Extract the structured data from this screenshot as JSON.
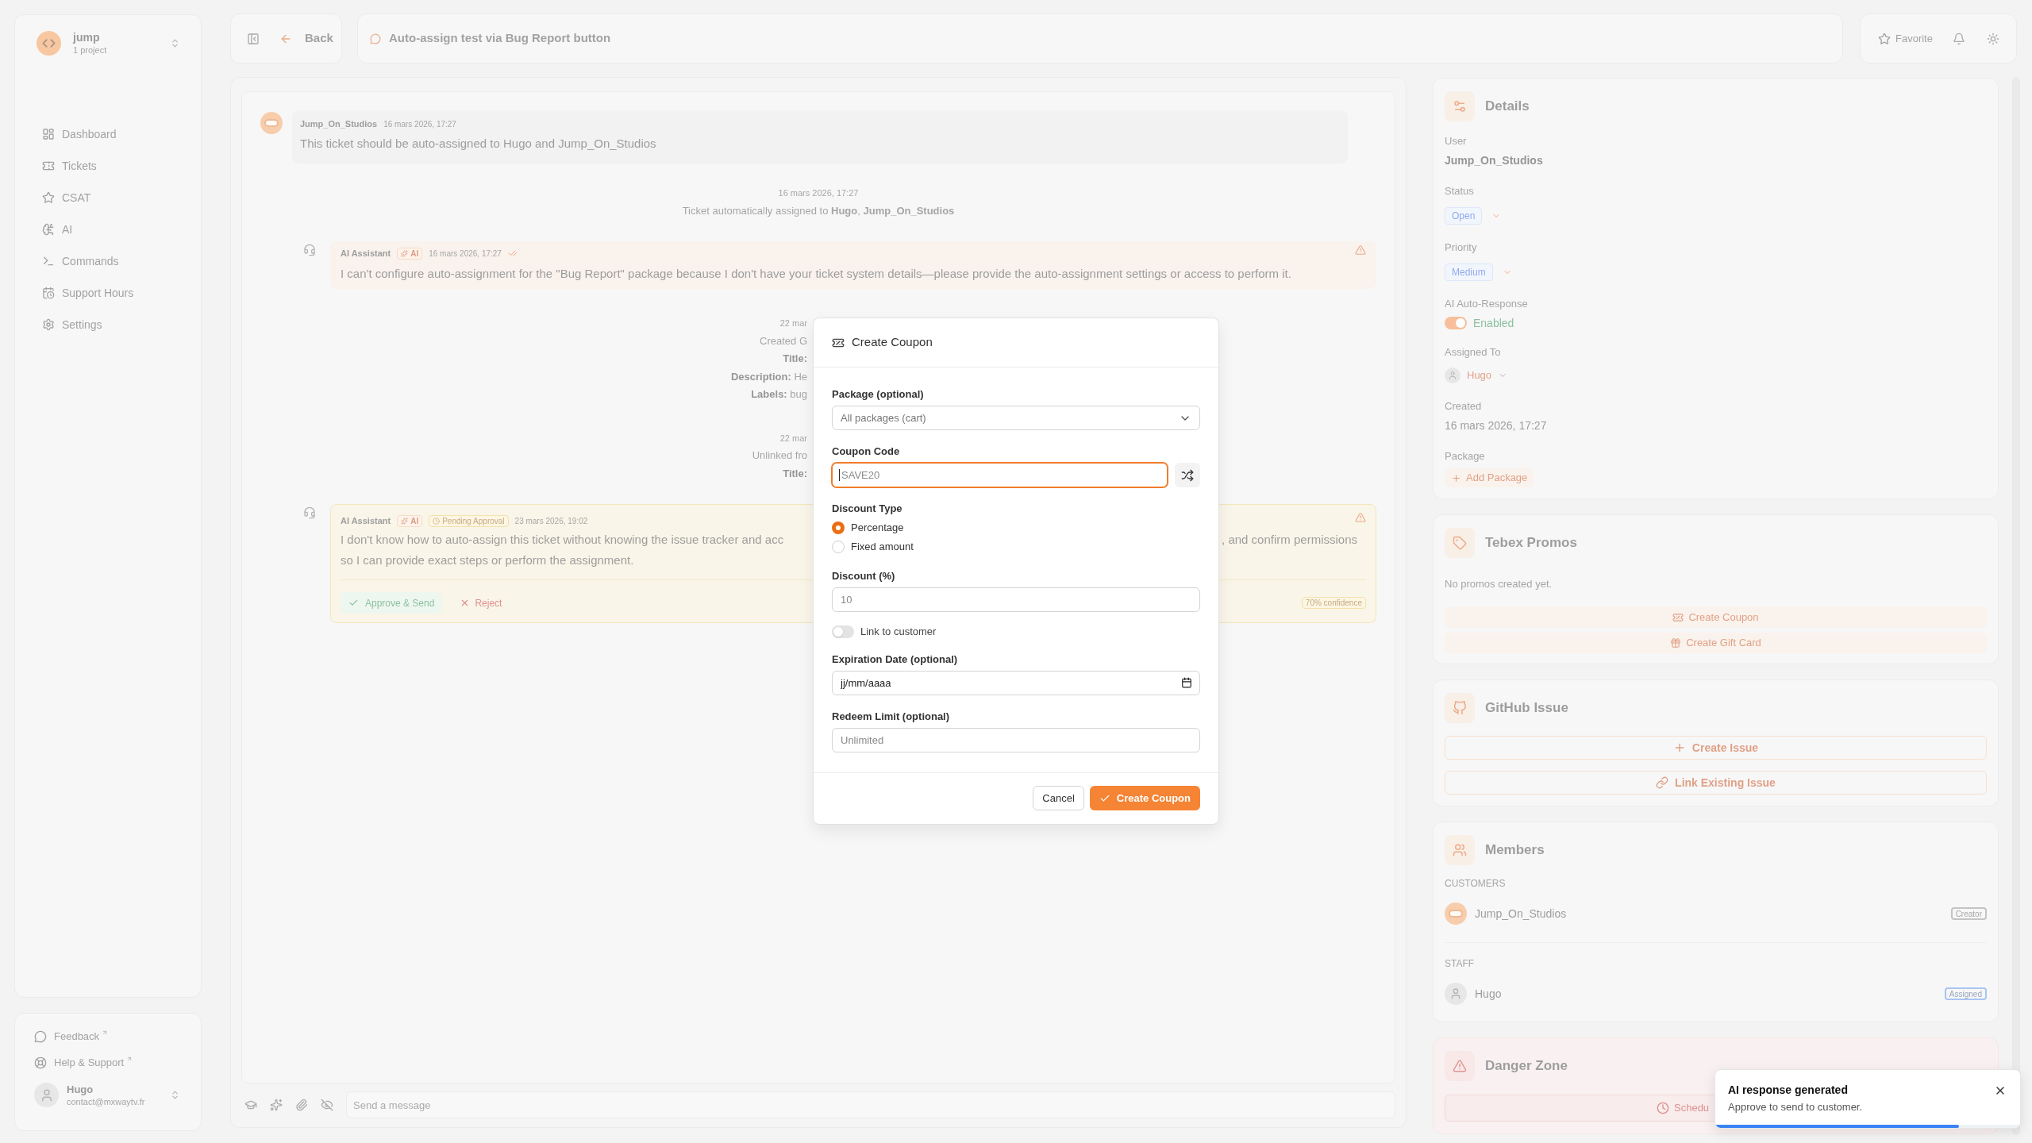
{
  "sidebar": {
    "workspace": {
      "name": "jump",
      "subtitle": "1 project"
    },
    "nav": [
      {
        "label": "Dashboard",
        "selected": false
      },
      {
        "label": "Tickets",
        "selected": false
      },
      {
        "label": "CSAT",
        "selected": false
      },
      {
        "label": "AI",
        "selected": false
      },
      {
        "label": "Commands",
        "selected": false
      },
      {
        "label": "Support Hours",
        "selected": false
      },
      {
        "label": "Settings",
        "selected": false
      }
    ],
    "links": [
      "Feedback",
      "Help & Support"
    ],
    "user": {
      "name": "Hugo",
      "email": "contact@mxwaytv.fr"
    }
  },
  "topbar": {
    "back": "Back",
    "title": "Auto-assign test via Bug Report button",
    "favorite": "Favorite"
  },
  "chat": {
    "messages": [
      {
        "kind": "customer",
        "author": "Jump_On_Studios",
        "time": "16 mars 2026, 17:27",
        "text": "This ticket should be auto-assigned to Hugo and Jump_On_Studios"
      },
      {
        "kind": "event",
        "date": "16 mars 2026, 17:27",
        "lines": [
          {
            "text": "Ticket automatically assigned to **Hugo**, **Jump_On_Studios**"
          }
        ]
      },
      {
        "kind": "assistant",
        "author": "AI Assistant",
        "badge": "AI",
        "time": "16 mars 2026, 17:27",
        "read": true,
        "pending": false,
        "text": "I can't configure auto-assignment for the \"Bug Report\" package because I don't have your ticket system details—please provide the auto-assignment settings or access to perform it."
      },
      {
        "kind": "clipped",
        "date": "22 mar",
        "lines": [
          {
            "text": "Created G"
          },
          {
            "label": "Title:"
          },
          {
            "label": "Description:",
            "value": "He"
          },
          {
            "label": "Labels:",
            "value": "bug"
          }
        ]
      },
      {
        "kind": "clipped",
        "date": "22 mar",
        "lines": [
          {
            "text": "Unlinked fro"
          },
          {
            "label": "Title:"
          }
        ]
      },
      {
        "kind": "assistant",
        "author": "AI Assistant",
        "badge": "AI",
        "status": "Pending Approval",
        "time": "23 mars 2026, 19:02",
        "read": false,
        "pending": true,
        "text_parts": [
          "I don't know how to auto-assign this ticket without knowing the issue tracker and acc",
          ", and confirm permissions"
        ],
        "text_more": "so I can provide exact steps or perform the assignment.",
        "actions": [
          {
            "label": "Approve & Send",
            "kind": "approve"
          },
          {
            "label": "Reject",
            "kind": "reject"
          }
        ],
        "confidence": "70% confidence"
      }
    ],
    "composer": {
      "placeholder": "Send a message"
    }
  },
  "details": {
    "title": "Details",
    "fields": [
      {
        "kind": "text",
        "label": "User",
        "value": "Jump_On_Studios",
        "emphasis": true
      },
      {
        "kind": "badge",
        "label": "Status",
        "value": "Open"
      },
      {
        "kind": "badge",
        "label": "Priority",
        "value": "Medium"
      },
      {
        "kind": "toggle",
        "label": "AI Auto-Response",
        "on": true,
        "value": "Enabled"
      },
      {
        "kind": "assignee",
        "label": "Assigned To",
        "value": "Hugo"
      },
      {
        "kind": "text",
        "label": "Created",
        "value": "16 mars 2026, 17:27",
        "emphasis": false
      },
      {
        "kind": "action",
        "label": "Package",
        "value": "Add Package"
      }
    ]
  },
  "promos": {
    "title": "Tebex Promos",
    "empty": "No promos created yet.",
    "buttons": [
      "Create Coupon",
      "Create Gift Card"
    ]
  },
  "github": {
    "title": "GitHub Issue",
    "buttons": [
      "Create Issue",
      "Link Existing Issue"
    ]
  },
  "members": {
    "title": "Members",
    "groups": [
      {
        "heading": "CUSTOMERS",
        "members": [
          {
            "kind": "customer",
            "name": "Jump_On_Studios",
            "role": "Creator",
            "color": "#c4c4c4"
          }
        ]
      },
      {
        "heading": "STAFF",
        "members": [
          {
            "kind": "staff",
            "name": "Hugo",
            "role": "Assigned",
            "color": "#a9c5f2"
          }
        ]
      }
    ]
  },
  "danger": {
    "title": "Danger Zone",
    "button": "Schedu"
  },
  "modal": {
    "title": "Create Coupon",
    "fields": [
      {
        "kind": "select",
        "label": "Package (optional)",
        "value": "All packages (cart)"
      },
      {
        "kind": "code",
        "label": "Coupon Code",
        "placeholder": "SAVE20",
        "focused": true
      },
      {
        "kind": "radio",
        "label": "Discount Type",
        "options": [
          {
            "label": "Percentage",
            "selected": true
          },
          {
            "label": "Fixed amount",
            "selected": false
          }
        ]
      },
      {
        "kind": "input",
        "label": "Discount (%)",
        "placeholder": "10"
      },
      {
        "kind": "switch",
        "label": "Link to customer",
        "on": false
      },
      {
        "kind": "date",
        "label": "Expiration Date (optional)",
        "placeholder": "jj/mm/aaaa"
      },
      {
        "kind": "input",
        "label": "Redeem Limit (optional)",
        "placeholder": "Unlimited"
      }
    ],
    "actions": [
      {
        "label": "Cancel",
        "kind": "secondary"
      },
      {
        "label": "Create Coupon",
        "kind": "primary"
      }
    ]
  },
  "toast": {
    "title": "AI response generated",
    "message": "Approve to send to customer.",
    "level": 0.8
  }
}
